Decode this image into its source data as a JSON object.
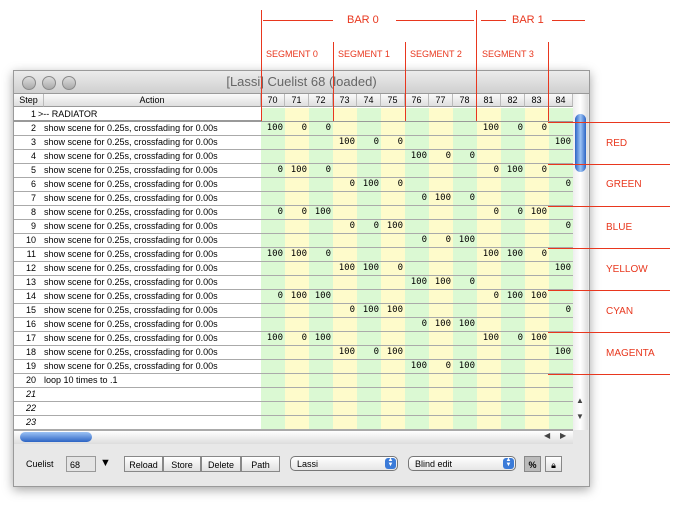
{
  "window": {
    "title": "[Lassi] Cuelist 68 (loaded)"
  },
  "columns": {
    "step": "Step",
    "action": "Action",
    "channels": [
      "70",
      "71",
      "72",
      "73",
      "74",
      "75",
      "76",
      "77",
      "78",
      "81",
      "82",
      "83",
      "84"
    ]
  },
  "colors": {
    "green": "#dbf9d3",
    "yellow": "#fefbcb",
    "annotation": "#e8371e"
  },
  "rows": [
    {
      "step": "1",
      "action": ">-- RADIATOR",
      "values": []
    },
    {
      "step": "2",
      "action": "show scene for 0.25s, crossfading for 0.00s",
      "values": [
        "100",
        "0",
        "0",
        "",
        "",
        "",
        "",
        "",
        "",
        "100",
        "0",
        "0",
        ""
      ]
    },
    {
      "step": "3",
      "action": "show scene for 0.25s, crossfading for 0.00s",
      "values": [
        "",
        "",
        "",
        "100",
        "0",
        "0",
        "",
        "",
        "",
        "",
        "",
        "",
        "100"
      ]
    },
    {
      "step": "4",
      "action": "show scene for 0.25s, crossfading for 0.00s",
      "values": [
        "",
        "",
        "",
        "",
        "",
        "",
        "100",
        "0",
        "0",
        "",
        "",
        "",
        ""
      ]
    },
    {
      "step": "5",
      "action": "show scene for 0.25s, crossfading for 0.00s",
      "values": [
        "0",
        "100",
        "0",
        "",
        "",
        "",
        "",
        "",
        "",
        "0",
        "100",
        "0",
        ""
      ]
    },
    {
      "step": "6",
      "action": "show scene for 0.25s, crossfading for 0.00s",
      "values": [
        "",
        "",
        "",
        "0",
        "100",
        "0",
        "",
        "",
        "",
        "",
        "",
        "",
        "0"
      ]
    },
    {
      "step": "7",
      "action": "show scene for 0.25s, crossfading for 0.00s",
      "values": [
        "",
        "",
        "",
        "",
        "",
        "",
        "0",
        "100",
        "0",
        "",
        "",
        "",
        ""
      ]
    },
    {
      "step": "8",
      "action": "show scene for 0.25s, crossfading for 0.00s",
      "values": [
        "0",
        "0",
        "100",
        "",
        "",
        "",
        "",
        "",
        "",
        "0",
        "0",
        "100",
        ""
      ]
    },
    {
      "step": "9",
      "action": "show scene for 0.25s, crossfading for 0.00s",
      "values": [
        "",
        "",
        "",
        "0",
        "0",
        "100",
        "",
        "",
        "",
        "",
        "",
        "",
        "0"
      ]
    },
    {
      "step": "10",
      "action": "show scene for 0.25s, crossfading for 0.00s",
      "values": [
        "",
        "",
        "",
        "",
        "",
        "",
        "0",
        "0",
        "100",
        "",
        "",
        "",
        ""
      ]
    },
    {
      "step": "11",
      "action": "show scene for 0.25s, crossfading for 0.00s",
      "values": [
        "100",
        "100",
        "0",
        "",
        "",
        "",
        "",
        "",
        "",
        "100",
        "100",
        "0",
        ""
      ]
    },
    {
      "step": "12",
      "action": "show scene for 0.25s, crossfading for 0.00s",
      "values": [
        "",
        "",
        "",
        "100",
        "100",
        "0",
        "",
        "",
        "",
        "",
        "",
        "",
        "100"
      ]
    },
    {
      "step": "13",
      "action": "show scene for 0.25s, crossfading for 0.00s",
      "values": [
        "",
        "",
        "",
        "",
        "",
        "",
        "100",
        "100",
        "0",
        "",
        "",
        "",
        ""
      ]
    },
    {
      "step": "14",
      "action": "show scene for 0.25s, crossfading for 0.00s",
      "values": [
        "0",
        "100",
        "100",
        "",
        "",
        "",
        "",
        "",
        "",
        "0",
        "100",
        "100",
        ""
      ]
    },
    {
      "step": "15",
      "action": "show scene for 0.25s, crossfading for 0.00s",
      "values": [
        "",
        "",
        "",
        "0",
        "100",
        "100",
        "",
        "",
        "",
        "",
        "",
        "",
        "0"
      ]
    },
    {
      "step": "16",
      "action": "show scene for 0.25s, crossfading for 0.00s",
      "values": [
        "",
        "",
        "",
        "",
        "",
        "",
        "0",
        "100",
        "100",
        "",
        "",
        "",
        ""
      ]
    },
    {
      "step": "17",
      "action": "show scene for 0.25s, crossfading for 0.00s",
      "values": [
        "100",
        "0",
        "100",
        "",
        "",
        "",
        "",
        "",
        "",
        "100",
        "0",
        "100",
        ""
      ]
    },
    {
      "step": "18",
      "action": "show scene for 0.25s, crossfading for 0.00s",
      "values": [
        "",
        "",
        "",
        "100",
        "0",
        "100",
        "",
        "",
        "",
        "",
        "",
        "",
        "100"
      ]
    },
    {
      "step": "19",
      "action": "show scene for 0.25s, crossfading for 0.00s",
      "values": [
        "",
        "",
        "",
        "",
        "",
        "",
        "100",
        "0",
        "100",
        "",
        "",
        "",
        ""
      ]
    },
    {
      "step": "20",
      "action": "loop 10 times to .1",
      "values": []
    },
    {
      "step": "21",
      "action": "",
      "values": []
    },
    {
      "step": "22",
      "action": "",
      "values": []
    },
    {
      "step": "23",
      "action": "",
      "values": []
    }
  ],
  "bottom": {
    "cuelist_label": "Cuelist",
    "cuelist_value": "68",
    "buttons": [
      "Reload",
      "Store",
      "Delete",
      "Path"
    ],
    "user_select": "Lassi",
    "mode_select": "Blind edit",
    "percent": "%"
  },
  "annotations": {
    "bars": [
      "BAR 0",
      "BAR 1"
    ],
    "segments": [
      "SEGMENT 0",
      "SEGMENT 1",
      "SEGMENT 2",
      "SEGMENT 3"
    ],
    "colors": [
      "RED",
      "GREEN",
      "BLUE",
      "YELLOW",
      "CYAN",
      "MAGENTA"
    ]
  }
}
